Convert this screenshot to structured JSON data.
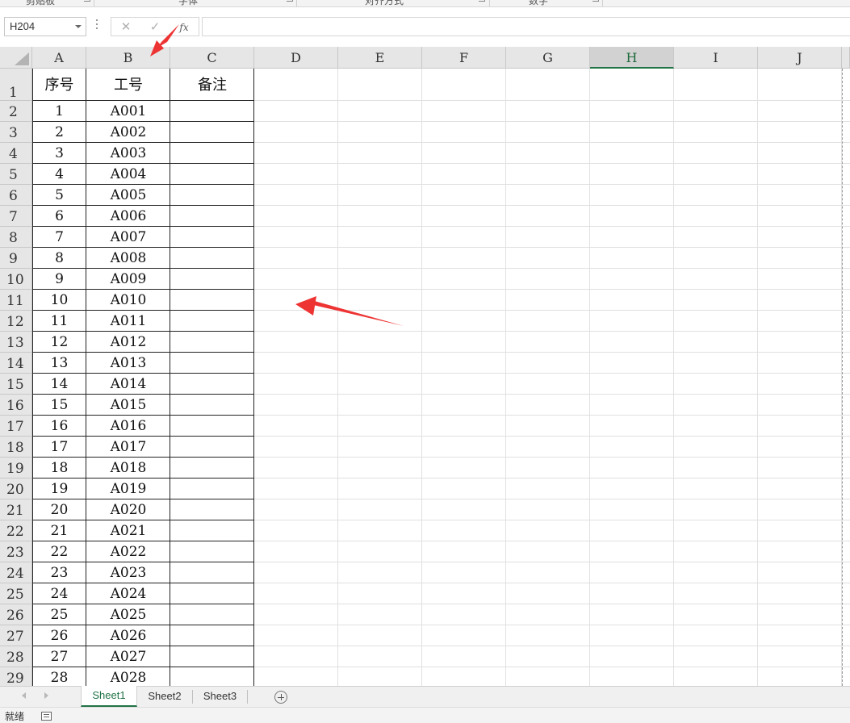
{
  "ribbon": {
    "groups": [
      "剪贴板",
      "字体",
      "对齐方式",
      "数字"
    ]
  },
  "formula_bar": {
    "name_box": "H204",
    "cancel_icon": "close-icon",
    "enter_icon": "check-icon",
    "fx_label": "fx",
    "formula_value": ""
  },
  "grid": {
    "columns": [
      "A",
      "B",
      "C",
      "D",
      "E",
      "F",
      "G",
      "H",
      "I",
      "J"
    ],
    "active_column": "H",
    "row_numbers": [
      "1",
      "2",
      "3",
      "4",
      "5",
      "6",
      "7",
      "8",
      "9",
      "10",
      "11",
      "12",
      "13",
      "14",
      "15",
      "16",
      "17",
      "18",
      "19",
      "20",
      "21",
      "22",
      "23",
      "24",
      "25",
      "26",
      "27",
      "28",
      "29"
    ]
  },
  "table": {
    "headers": [
      "序号",
      "工号",
      "备注"
    ],
    "rows": [
      [
        "1",
        "A001",
        ""
      ],
      [
        "2",
        "A002",
        ""
      ],
      [
        "3",
        "A003",
        ""
      ],
      [
        "4",
        "A004",
        ""
      ],
      [
        "5",
        "A005",
        ""
      ],
      [
        "6",
        "A006",
        ""
      ],
      [
        "7",
        "A007",
        ""
      ],
      [
        "8",
        "A008",
        ""
      ],
      [
        "9",
        "A009",
        ""
      ],
      [
        "10",
        "A010",
        ""
      ],
      [
        "11",
        "A011",
        ""
      ],
      [
        "12",
        "A012",
        ""
      ],
      [
        "13",
        "A013",
        ""
      ],
      [
        "14",
        "A014",
        ""
      ],
      [
        "15",
        "A015",
        ""
      ],
      [
        "16",
        "A016",
        ""
      ],
      [
        "17",
        "A017",
        ""
      ],
      [
        "18",
        "A018",
        ""
      ],
      [
        "19",
        "A019",
        ""
      ],
      [
        "20",
        "A020",
        ""
      ],
      [
        "21",
        "A021",
        ""
      ],
      [
        "22",
        "A022",
        ""
      ],
      [
        "23",
        "A023",
        ""
      ],
      [
        "24",
        "A024",
        ""
      ],
      [
        "25",
        "A025",
        ""
      ],
      [
        "26",
        "A026",
        ""
      ],
      [
        "27",
        "A027",
        ""
      ],
      [
        "28",
        "A028",
        ""
      ]
    ]
  },
  "sheets": {
    "tabs": [
      "Sheet1",
      "Sheet2",
      "Sheet3"
    ],
    "active": "Sheet1"
  },
  "status": {
    "text": "就绪"
  },
  "colors": {
    "accent": "#217346",
    "annotation": "#ee3333"
  }
}
